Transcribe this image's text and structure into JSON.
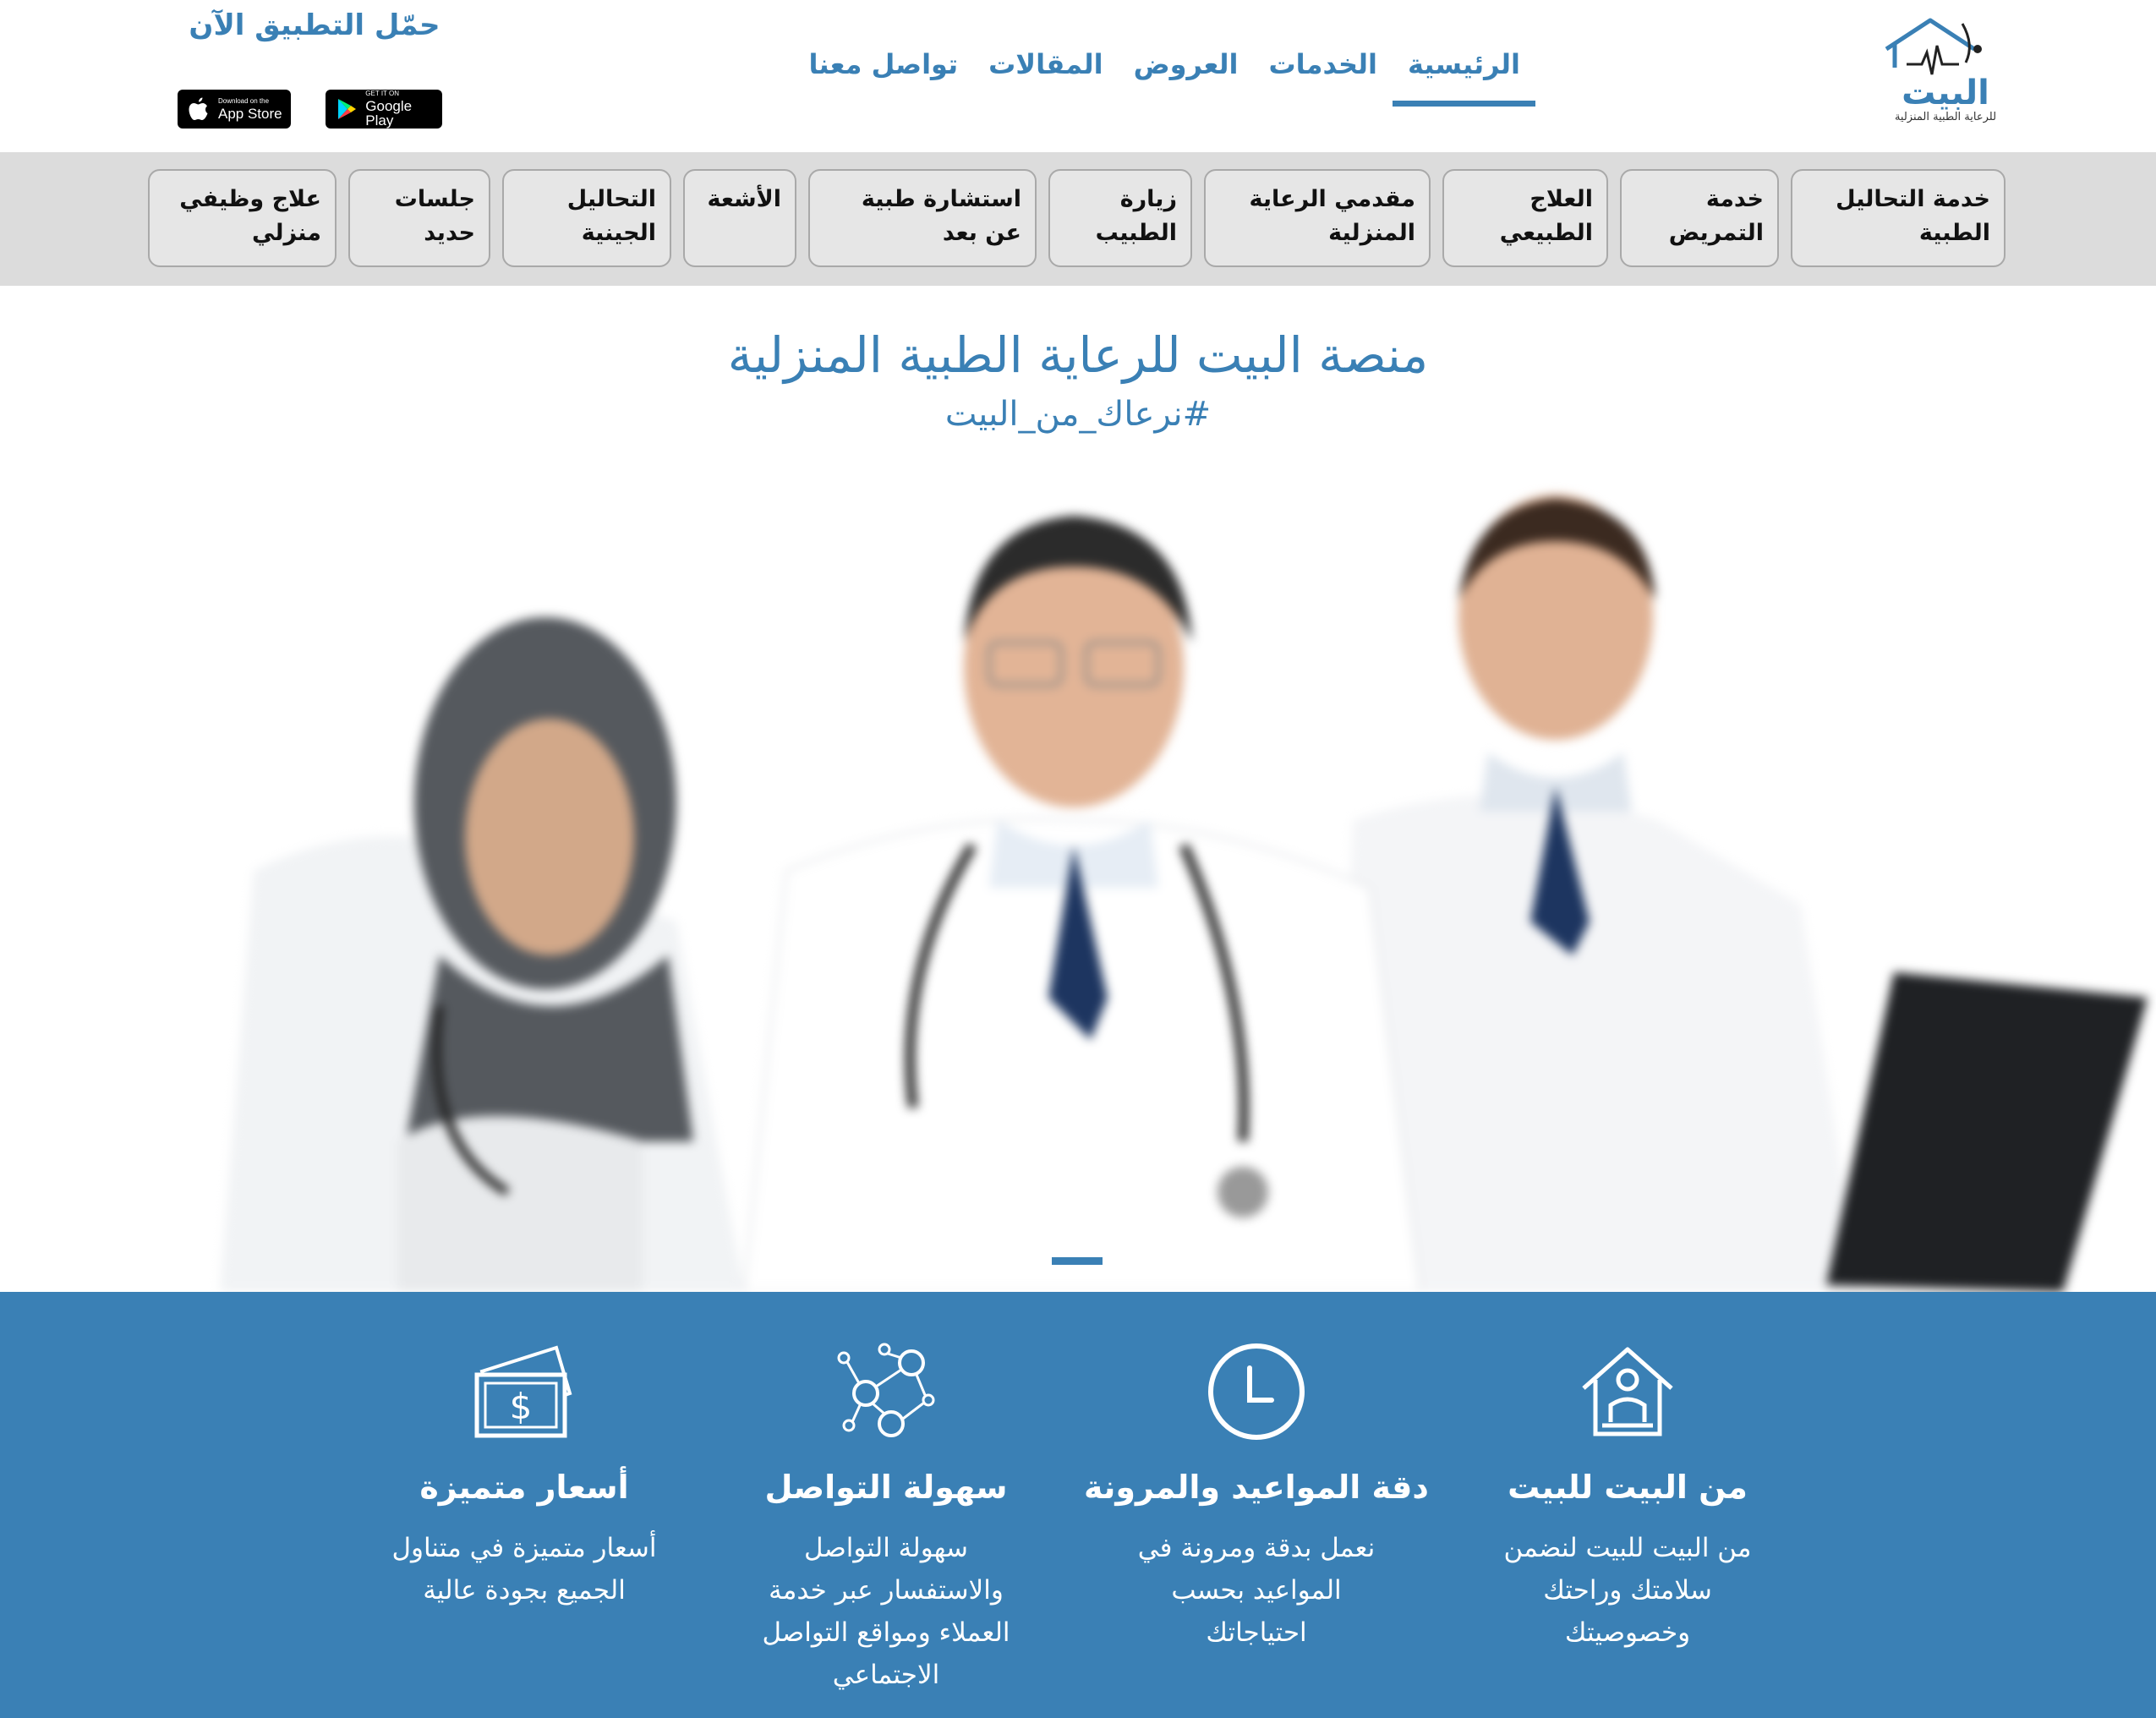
{
  "header": {
    "logo": {
      "name": "البيت",
      "subtitle": "للرعاية الطبية المنزلية"
    },
    "nav": [
      {
        "label": "الرئيسية",
        "active": true
      },
      {
        "label": "الخدمات",
        "active": false
      },
      {
        "label": "العروض",
        "active": false
      },
      {
        "label": "المقالات",
        "active": false
      },
      {
        "label": "تواصل معنا",
        "active": false
      }
    ],
    "app_download": {
      "title": "حمّل التطبيق الآن",
      "app_store": {
        "small": "Download on the",
        "big": "App Store",
        "icon": "apple-icon"
      },
      "google_play": {
        "small": "GET IT ON",
        "big": "Google Play",
        "icon": "google-play-icon"
      }
    }
  },
  "services": [
    {
      "line1": "خدمة التحاليل",
      "line2": "الطبية"
    },
    {
      "line1": "خدمة",
      "line2": "التمريض"
    },
    {
      "line1": "العلاج",
      "line2": "الطبيعي"
    },
    {
      "line1": "مقدمي الرعاية",
      "line2": "المنزلية"
    },
    {
      "line1": "زيارة",
      "line2": "الطبيب"
    },
    {
      "line1": "استشارة طبية",
      "line2": "عن بعد"
    },
    {
      "line1": "الأشعة",
      "line2": ""
    },
    {
      "line1": "التحاليل",
      "line2": "الجينية"
    },
    {
      "line1": "جلسات",
      "line2": "حديد"
    },
    {
      "line1": "علاج وظيفي",
      "line2": "منزلي"
    }
  ],
  "hero": {
    "title": "منصة البيت للرعاية الطبية المنزلية",
    "hashtag": "#نرعاك_من_البيت"
  },
  "features": [
    {
      "icon": "house-person-icon",
      "title": "من البيت للبيت",
      "lines": [
        "من البيت للبيت لنضمن",
        "سلامتك وراحتك",
        "وخصوصيتك"
      ]
    },
    {
      "icon": "clock-icon",
      "title": "دقة المواعيد والمرونة",
      "lines": [
        "نعمل بدقة ومرونة في",
        "المواعيد بحسب",
        "احتياجاتك"
      ]
    },
    {
      "icon": "network-people-icon",
      "title": "سهولة التواصل",
      "lines": [
        "سهولة التواصل",
        "والاستفسار عبر خدمة",
        "العملاء ومواقع التواصل",
        "الاجتماعي"
      ]
    },
    {
      "icon": "money-icon",
      "title": "أسعار متميزة",
      "lines": [
        "أسعار متميزة في متناول",
        "الجميع بجودة عالية"
      ]
    }
  ],
  "colors": {
    "primary": "#3a80b5",
    "services_bg": "#dcdcdc",
    "service_border": "#a9a9a9"
  }
}
